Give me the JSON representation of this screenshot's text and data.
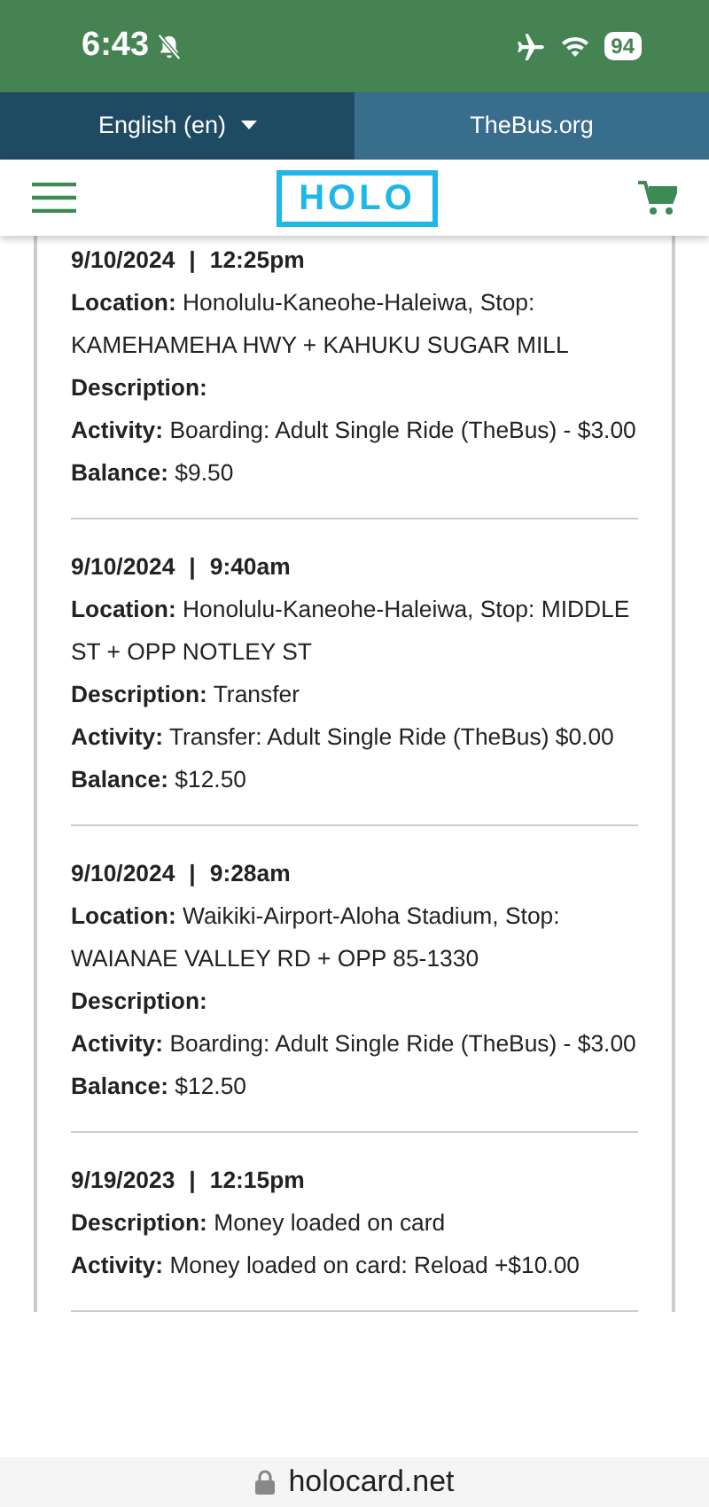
{
  "status_bar": {
    "time": "6:43",
    "silent": true,
    "battery": "94"
  },
  "top_links": [
    {
      "label": "English (en)",
      "dropdown": true
    },
    {
      "label": "TheBus.org",
      "dropdown": false
    }
  ],
  "header": {
    "logo": "HOLO"
  },
  "transactions": [
    {
      "date": "9/10/2024",
      "separator": "|",
      "time": "12:25pm",
      "fields": [
        "**Location:** Honolulu-Kaneohe-Haleiwa, Stop: KAMEHAMEHA HWY + KAHUKU SUGAR MILL",
        "**Description:**",
        "**Activity:** Boarding: Adult Single Ride (TheBus) - $3.00",
        "**Balance:** $9.50"
      ]
    },
    {
      "date": "9/10/2024",
      "separator": "|",
      "time": "9:40am",
      "fields": [
        "**Location:** Honolulu-Kaneohe-Haleiwa, Stop: MIDDLE ST + OPP NOTLEY ST",
        "**Description:** Transfer",
        "**Activity:** Transfer: Adult Single Ride (TheBus) $0.00",
        "**Balance:** $12.50"
      ]
    },
    {
      "date": "9/10/2024",
      "separator": "|",
      "time": "9:28am",
      "fields": [
        "**Location:** Waikiki-Airport-Aloha Stadium, Stop: WAIANAE VALLEY RD + OPP 85-1330",
        "**Description:**",
        "**Activity:** Boarding: Adult Single Ride (TheBus) - $3.00",
        "**Balance:** $12.50"
      ]
    },
    {
      "date": "9/19/2023",
      "separator": "|",
      "time": "12:15pm",
      "fields": [
        "**Description:** Money loaded on card",
        "**Activity:** Money loaded on card: Reload +$10.00"
      ]
    }
  ],
  "address_bar": {
    "url": "holocard.net",
    "secure": true
  }
}
